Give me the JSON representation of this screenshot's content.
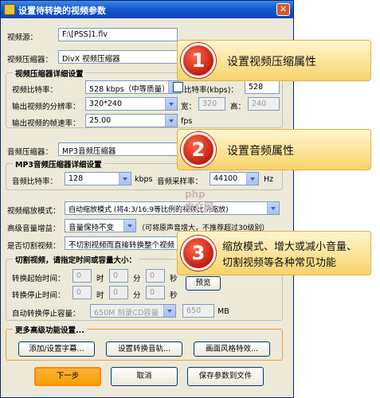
{
  "window": {
    "title": "设置待转换的视频参数",
    "close_glyph": "✕"
  },
  "video_source": {
    "label": "视频源：",
    "value": "F:\\[PSS]1.flv"
  },
  "video_compressor": {
    "label": "视频压缩器：",
    "value": "DivX 视频压缩器"
  },
  "video_settings": {
    "title": "视频压缩器详细设置",
    "bitrate_label": "视频比特率：",
    "bitrate_value": "528  kbps（中等质量）",
    "bitrate_check_label": "比特率(kbps)：",
    "bitrate_kbps": "528",
    "resolution_label": "输出视频的分辨率：",
    "resolution_value": "320*240",
    "width_label": "宽：",
    "width_value": "320",
    "height_label": "高：",
    "height_value": "240",
    "framerate_label": "输出视频的帧速率：",
    "framerate_value": "25.00",
    "fps_label": "fps"
  },
  "audio_compressor": {
    "label": "音频压缩器：",
    "value": "MP3音频压缩器"
  },
  "audio_settings": {
    "title": "MP3音频压缩器详细设置",
    "bitrate_label": "音频比特率：",
    "bitrate_value": "128",
    "kbps_label": "kbps",
    "samplerate_label": "音频采样率：",
    "samplerate_value": "44100",
    "hz_label": "Hz"
  },
  "scale_mode": {
    "label": "视频缩放模式：",
    "value": "自动缩放模式 (将4:3/16:9等比例的视频比例缩放)"
  },
  "volume_gain": {
    "label": "高级音量增益：",
    "value": "音量保持不变",
    "hint": "（可将原声音增大，不推荐超过30级别）"
  },
  "cut_video": {
    "label": "是否切割视频：",
    "value": "不切割视频而直接转换整个视频"
  },
  "cut_group": {
    "title": "切割视频，请指定时间或容量大小：",
    "start_label": "转换起始时间：",
    "stop_label": "转换停止时间：",
    "hour": "时",
    "minute": "分",
    "second": "秒",
    "zero": "0",
    "preview_button": "预览",
    "auto_stop_label": "自动转换停止容量：",
    "auto_stop_value": "650M 刻录CD容量",
    "auto_stop_mb": "650",
    "mb_label": "MB"
  },
  "advanced": {
    "title": "更多高级功能设置...",
    "subtitle_button": "添加/设置字幕...",
    "audio_button": "设置转换音轨...",
    "style_button": "画面风格特效..."
  },
  "footer": {
    "next_button": "下一步",
    "cancel_button": "取消",
    "save_button": "保存参数到文件"
  },
  "callouts": [
    {
      "num": "1",
      "text": "设置视频压缩属性"
    },
    {
      "num": "2",
      "text": "设置音频属性"
    },
    {
      "num": "3",
      "text": "缩放模式、增大或减小音量、",
      "text2": "切割视频等各种常见功能"
    }
  ],
  "watermark": "php 中文网"
}
